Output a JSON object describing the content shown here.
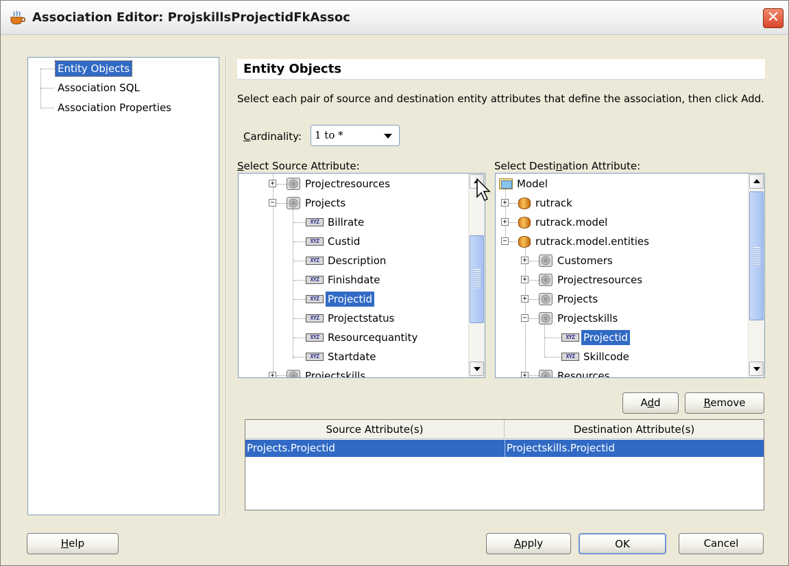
{
  "window": {
    "title": "Association Editor: ProjskillsProjectidFkAssoc",
    "close_glyph": "✕"
  },
  "nav": {
    "items": [
      {
        "label": "Entity Objects",
        "selected": true
      },
      {
        "label": "Association SQL",
        "selected": false
      },
      {
        "label": "Association Properties",
        "selected": false
      }
    ]
  },
  "panel": {
    "heading": "Entity Objects",
    "description": "Select each pair of source and destination entity attributes that define the association, then click Add.",
    "cardinality_label_u": "C",
    "cardinality_label_rest": "ardinality:",
    "cardinality_value": "1 to *"
  },
  "source_tree": {
    "label_u": "S",
    "label_rest": "elect Source Attribute:",
    "entities": [
      "Projectresources",
      "Projects",
      "Projectskills"
    ],
    "attributes": [
      "Billrate",
      "Custid",
      "Description",
      "Finishdate",
      "Projectid",
      "Projectstatus",
      "Resourcequantity",
      "Startdate"
    ],
    "selected": "Projectid"
  },
  "dest_tree": {
    "label_pre": "Select Desti",
    "label_u": "n",
    "label_rest": "ation Attribute:",
    "root": "Model",
    "packages": [
      "rutrack",
      "rutrack.model",
      "rutrack.model.entities"
    ],
    "entities": [
      "Customers",
      "Projectresources",
      "Projects",
      "Projectskills"
    ],
    "attributes": [
      "Projectid",
      "Skillcode"
    ],
    "last_entity": "Resources",
    "selected": "Projectid"
  },
  "buttons": {
    "add_pre": "A",
    "add_u": "d",
    "add_rest": "d",
    "remove_u": "R",
    "remove_rest": "emove",
    "help_u": "H",
    "help_rest": "elp",
    "apply_u": "A",
    "apply_rest": "pply",
    "ok": "OK",
    "cancel": "Cancel"
  },
  "table": {
    "columns": [
      "Source Attribute(s)",
      "Destination Attribute(s)"
    ],
    "rows": [
      {
        "source": "Projects.Projectid",
        "destination": "Projectskills.Projectid",
        "selected": true
      }
    ]
  },
  "icons": {
    "entity": "entity-gear-icon",
    "attribute": "attribute-xyz-icon",
    "package": "package-icon",
    "folder": "folder-icon",
    "attribute_badge": "XYZ"
  },
  "colors": {
    "selection": "#316ac5",
    "window_bg": "#ece9d8",
    "close_red": "#d9452a"
  }
}
